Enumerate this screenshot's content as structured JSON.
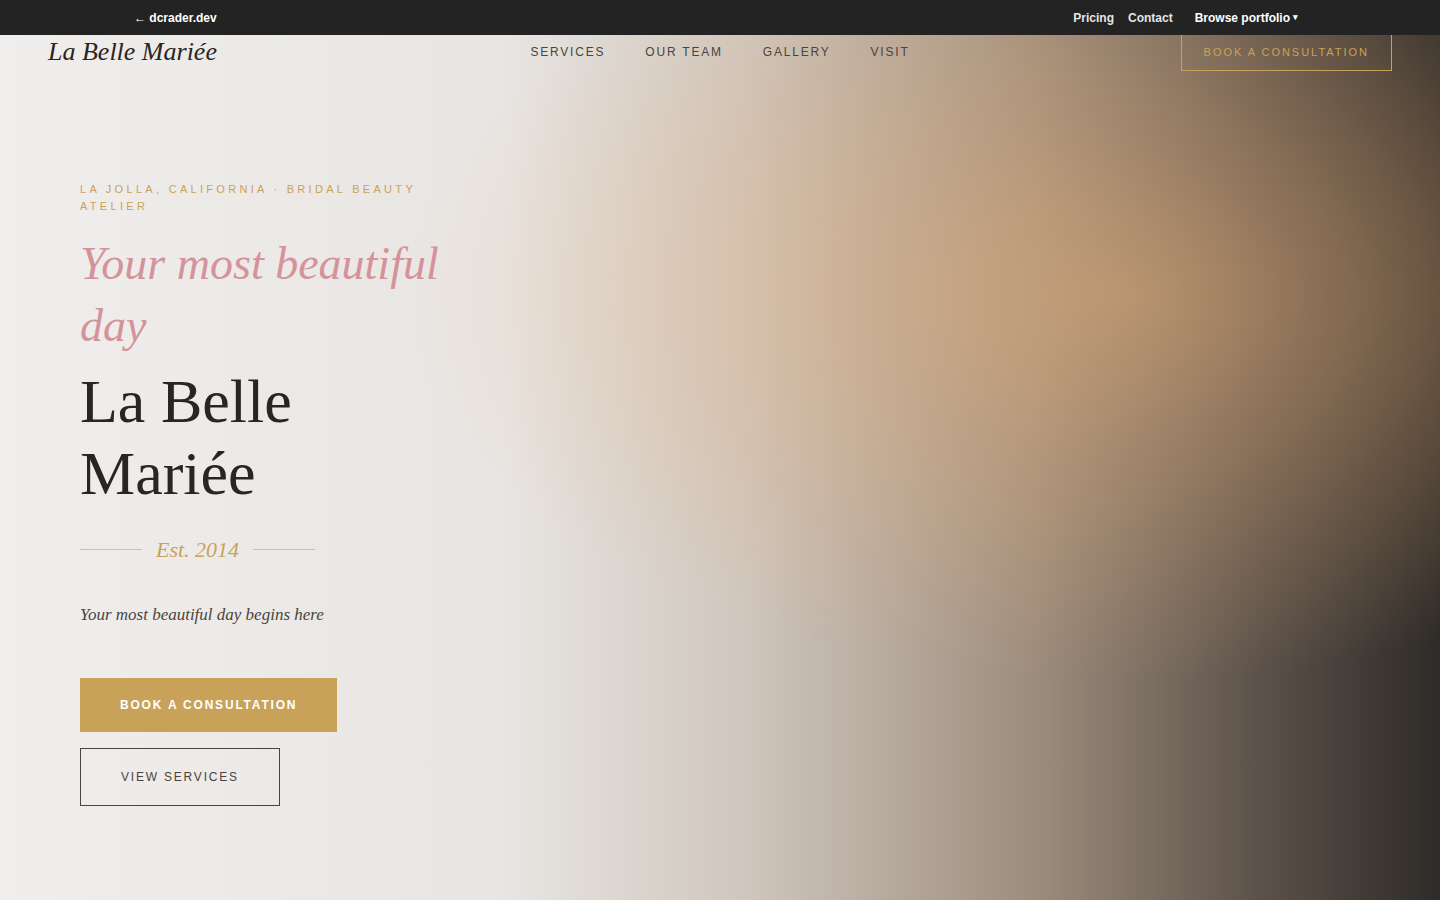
{
  "top_bar": {
    "back_link": "← dcrader.dev",
    "links": [
      "Pricing",
      "Contact"
    ],
    "portfolio": {
      "label": "Browse portfolio",
      "caret": "▾"
    }
  },
  "header": {
    "logo": "La Belle Mariée",
    "nav": [
      "SERVICES",
      "OUR TEAM",
      "GALLERY",
      "VISIT"
    ],
    "cta": "BOOK A CONSULTATION"
  },
  "hero": {
    "eyebrow": "LA JOLLA, CALIFORNIA · BRIDAL BEAUTY ATELIER",
    "script_heading": "Your most beautiful day",
    "title": "La Belle Mariée",
    "established": "Est. 2014",
    "subtitle": "Your most beautiful day begins here",
    "buttons": [
      {
        "label": "BOOK A CONSULTATION",
        "kind": "primary"
      },
      {
        "label": "VIEW SERVICES",
        "kind": "outline"
      }
    ]
  }
}
